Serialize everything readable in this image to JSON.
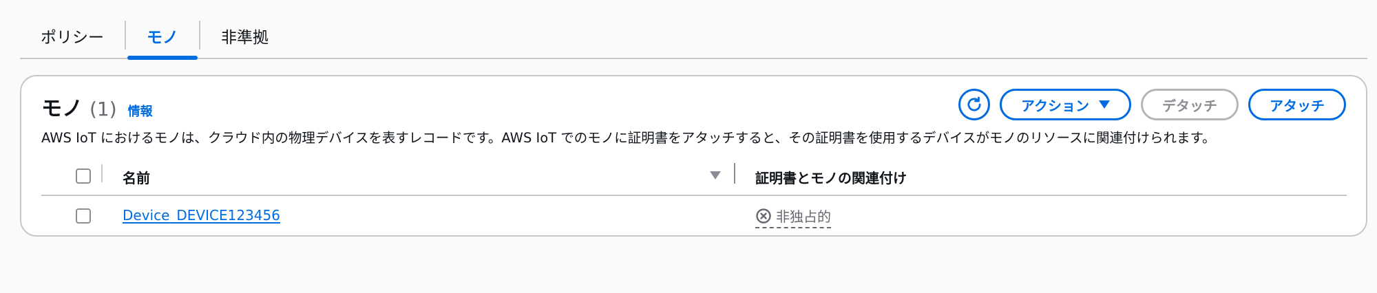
{
  "tabs": [
    {
      "label": "ポリシー",
      "active": false
    },
    {
      "label": "モノ",
      "active": true
    },
    {
      "label": "非準拠",
      "active": false
    }
  ],
  "panel": {
    "title": "モノ",
    "count": "(1)",
    "info_label": "情報",
    "description": "AWS IoT におけるモノは、クラウド内の物理デバイスを表すレコードです。AWS IoT でのモノに証明書をアタッチすると、その証明書を使用するデバイスがモノのリソースに関連付けられます。",
    "actions": {
      "refresh_icon": "refresh-icon",
      "action_label": "アクション",
      "detach_label": "デタッチ",
      "attach_label": "アタッチ"
    }
  },
  "table": {
    "columns": [
      "名前",
      "証明書とモノの関連付け"
    ],
    "rows": [
      {
        "name": "Device_DEVICE123456",
        "association": "非独占的",
        "association_icon": "x-circle-icon"
      }
    ]
  },
  "colors": {
    "accent": "#006ce0",
    "border": "#c6c6cd",
    "muted": "#656871"
  }
}
